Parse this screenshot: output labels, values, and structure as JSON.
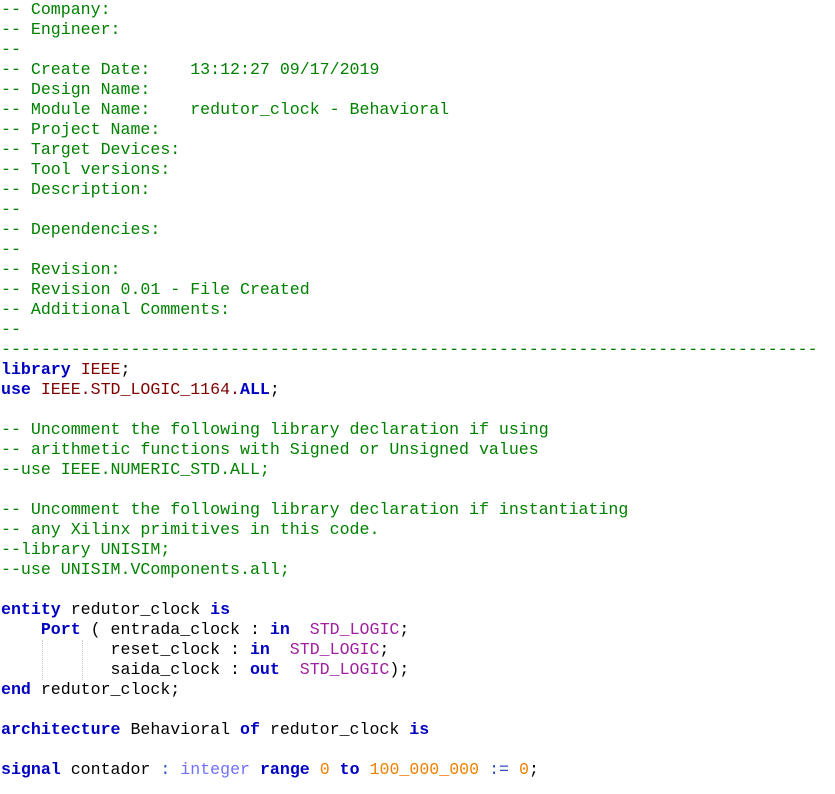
{
  "editor": {
    "lines": [
      [
        {
          "t": "-- Company:",
          "c": "comment"
        }
      ],
      [
        {
          "t": "-- Engineer:",
          "c": "comment"
        }
      ],
      [
        {
          "t": "--",
          "c": "comment"
        }
      ],
      [
        {
          "t": "-- Create Date:    13:12:27 09/17/2019",
          "c": "comment"
        }
      ],
      [
        {
          "t": "-- Design Name:",
          "c": "comment"
        }
      ],
      [
        {
          "t": "-- Module Name:    redutor_clock - Behavioral",
          "c": "comment"
        }
      ],
      [
        {
          "t": "-- Project Name:",
          "c": "comment"
        }
      ],
      [
        {
          "t": "-- Target Devices:",
          "c": "comment"
        }
      ],
      [
        {
          "t": "-- Tool versions:",
          "c": "comment"
        }
      ],
      [
        {
          "t": "-- Description:",
          "c": "comment"
        }
      ],
      [
        {
          "t": "--",
          "c": "comment"
        }
      ],
      [
        {
          "t": "-- Dependencies:",
          "c": "comment"
        }
      ],
      [
        {
          "t": "--",
          "c": "comment"
        }
      ],
      [
        {
          "t": "-- Revision:",
          "c": "comment"
        }
      ],
      [
        {
          "t": "-- Revision 0.01 - File Created",
          "c": "comment"
        }
      ],
      [
        {
          "t": "-- Additional Comments:",
          "c": "comment"
        }
      ],
      [
        {
          "t": "--",
          "c": "comment"
        }
      ],
      [
        {
          "t": "----------------------------------------------------------------------------------",
          "c": "sep"
        }
      ],
      [
        {
          "t": "library",
          "c": "kw"
        },
        {
          "t": " ",
          "c": "punct"
        },
        {
          "t": "IEEE",
          "c": "lib"
        },
        {
          "t": ";",
          "c": "punct"
        }
      ],
      [
        {
          "t": "use",
          "c": "kw"
        },
        {
          "t": " ",
          "c": "punct"
        },
        {
          "t": "IEEE.STD_LOGIC_1164.",
          "c": "lib"
        },
        {
          "t": "ALL",
          "c": "kw"
        },
        {
          "t": ";",
          "c": "punct"
        }
      ],
      [
        {
          "t": "",
          "c": "punct"
        }
      ],
      [
        {
          "t": "-- Uncomment the following library declaration if using",
          "c": "comment"
        }
      ],
      [
        {
          "t": "-- arithmetic functions with Signed or Unsigned values",
          "c": "comment"
        }
      ],
      [
        {
          "t": "--use IEEE.NUMERIC_STD.ALL;",
          "c": "comment"
        }
      ],
      [
        {
          "t": "",
          "c": "punct"
        }
      ],
      [
        {
          "t": "-- Uncomment the following library declaration if instantiating",
          "c": "comment"
        }
      ],
      [
        {
          "t": "-- any Xilinx primitives in this code.",
          "c": "comment"
        }
      ],
      [
        {
          "t": "--library UNISIM;",
          "c": "comment"
        }
      ],
      [
        {
          "t": "--use UNISIM.VComponents.all;",
          "c": "comment"
        }
      ],
      [
        {
          "t": "",
          "c": "punct"
        }
      ],
      [
        {
          "t": "entity",
          "c": "kw"
        },
        {
          "t": " redutor_clock ",
          "c": "ident"
        },
        {
          "t": "is",
          "c": "kw"
        }
      ],
      [
        {
          "t": "    ",
          "c": "punct"
        },
        {
          "t": "Port",
          "c": "kw"
        },
        {
          "t": " ( entrada_clock : ",
          "c": "ident"
        },
        {
          "t": "in",
          "c": "kw"
        },
        {
          "t": "  ",
          "c": "punct"
        },
        {
          "t": "STD_LOGIC",
          "c": "type"
        },
        {
          "t": ";",
          "c": "punct"
        }
      ],
      [
        {
          "t": "           reset_clock : ",
          "c": "ident"
        },
        {
          "t": "in",
          "c": "kw"
        },
        {
          "t": "  ",
          "c": "punct"
        },
        {
          "t": "STD_LOGIC",
          "c": "type"
        },
        {
          "t": ";",
          "c": "punct"
        }
      ],
      [
        {
          "t": "           saida_clock : ",
          "c": "ident"
        },
        {
          "t": "out",
          "c": "kw"
        },
        {
          "t": "  ",
          "c": "punct"
        },
        {
          "t": "STD_LOGIC",
          "c": "type"
        },
        {
          "t": ");",
          "c": "punct"
        }
      ],
      [
        {
          "t": "end",
          "c": "kw"
        },
        {
          "t": " redutor_clock;",
          "c": "ident"
        }
      ],
      [
        {
          "t": "",
          "c": "punct"
        }
      ],
      [
        {
          "t": "architecture",
          "c": "kw"
        },
        {
          "t": " Behavioral ",
          "c": "ident"
        },
        {
          "t": "of",
          "c": "kw"
        },
        {
          "t": " redutor_clock ",
          "c": "ident"
        },
        {
          "t": "is",
          "c": "kw"
        }
      ],
      [
        {
          "t": "",
          "c": "punct"
        }
      ],
      [
        {
          "t": "signal",
          "c": "kw"
        },
        {
          "t": " contador ",
          "c": "ident"
        },
        {
          "t": ":",
          "c": "opblue"
        },
        {
          "t": " ",
          "c": "punct"
        },
        {
          "t": "integer",
          "c": "typekw"
        },
        {
          "t": " ",
          "c": "punct"
        },
        {
          "t": "range",
          "c": "kw"
        },
        {
          "t": " ",
          "c": "punct"
        },
        {
          "t": "0",
          "c": "num"
        },
        {
          "t": " ",
          "c": "punct"
        },
        {
          "t": "to",
          "c": "kw"
        },
        {
          "t": " ",
          "c": "punct"
        },
        {
          "t": "100_000_000",
          "c": "num"
        },
        {
          "t": " ",
          "c": "punct"
        },
        {
          "t": ":=",
          "c": "opblue"
        },
        {
          "t": " ",
          "c": "punct"
        },
        {
          "t": "0",
          "c": "num"
        },
        {
          "t": ";",
          "c": "punct"
        }
      ]
    ]
  },
  "colors": {
    "comment": "#008000",
    "keyword": "#0000c0",
    "library": "#800000",
    "std_logic": "#a020a0",
    "integer": "#7070ff",
    "number": "#f08000"
  }
}
